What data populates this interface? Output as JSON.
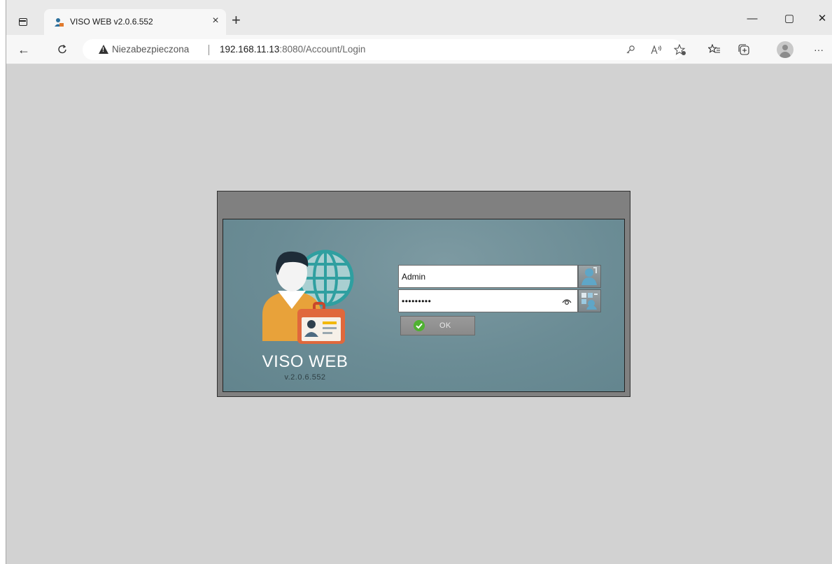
{
  "browser": {
    "tab_title": "VISO WEB v2.0.6.552",
    "tab_close": "×",
    "new_tab": "+",
    "minimize": "—",
    "maximize": "▢",
    "close": "✕",
    "back": "←",
    "refresh": "C",
    "security_label": "Niezabezpieczona",
    "url_host": "192.168.11.13",
    "url_rest": ":8080/Account/Login",
    "more": "···",
    "icons": [
      "tab-actions-icon",
      "key-icon",
      "read-aloud-icon",
      "add-favorite-icon",
      "favorites-icon",
      "collections-icon",
      "profile-avatar-icon",
      "more-icon"
    ]
  },
  "login": {
    "brand_name": "VISO WEB",
    "version": "v.2.0.6.552",
    "username_value": "Admin",
    "password_value": "123456789",
    "ok_label": "OK",
    "colors": {
      "panel": "#6b8c95",
      "frame": "#808080",
      "ok_check": "#4fb131"
    }
  }
}
